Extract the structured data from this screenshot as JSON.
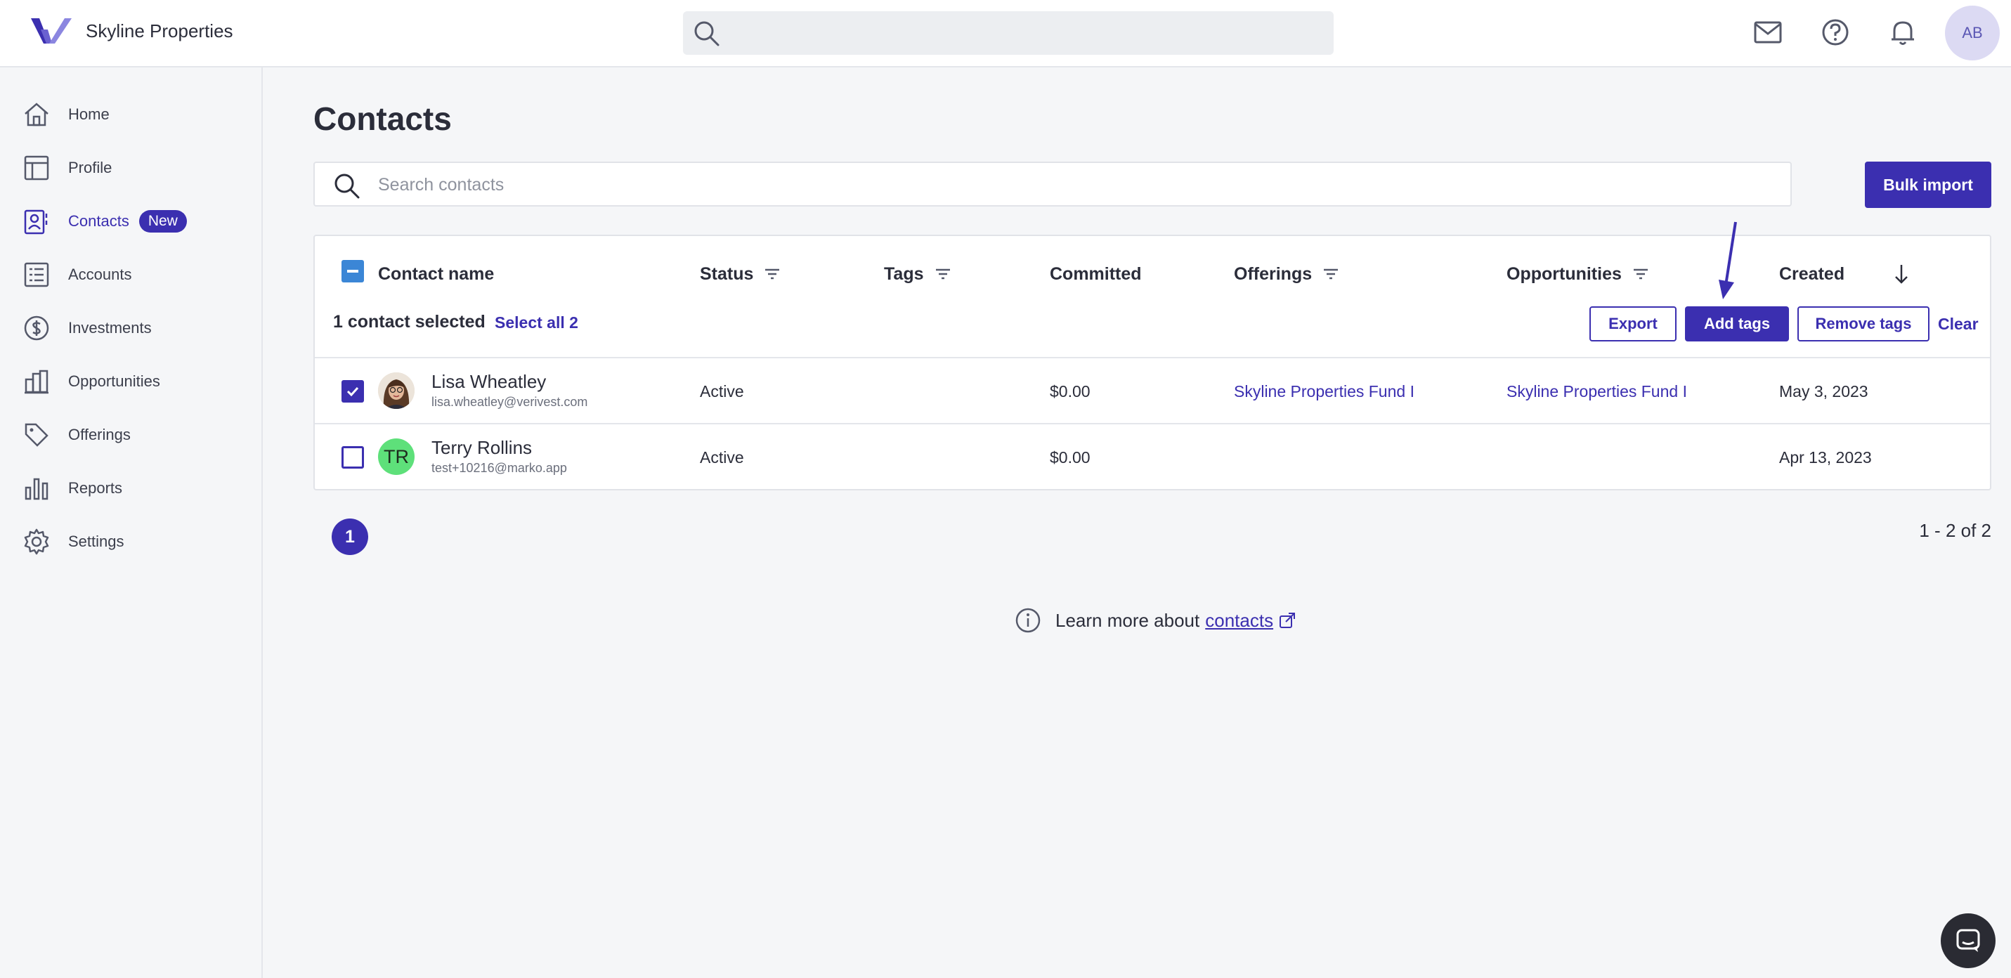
{
  "header": {
    "brand_name": "Skyline Properties",
    "search_placeholder": "",
    "user_initials": "AB",
    "icons": [
      "mail-icon",
      "help-icon",
      "bell-icon"
    ]
  },
  "sidebar": {
    "items": [
      {
        "label": "Home",
        "icon": "home-icon"
      },
      {
        "label": "Profile",
        "icon": "profile-icon"
      },
      {
        "label": "Contacts",
        "icon": "contacts-icon",
        "badge": "New",
        "active": true
      },
      {
        "label": "Accounts",
        "icon": "accounts-icon"
      },
      {
        "label": "Investments",
        "icon": "dollar-icon"
      },
      {
        "label": "Opportunities",
        "icon": "building-icon"
      },
      {
        "label": "Offerings",
        "icon": "tag-icon"
      },
      {
        "label": "Reports",
        "icon": "bar-chart-icon"
      },
      {
        "label": "Settings",
        "icon": "gear-icon"
      }
    ]
  },
  "main": {
    "title": "Contacts",
    "search_placeholder": "Search contacts",
    "bulk_import_label": "Bulk import",
    "table": {
      "columns": [
        "Contact name",
        "Status",
        "Tags",
        "Committed",
        "Offerings",
        "Opportunities",
        "Created"
      ],
      "selection": {
        "count_text": "1 contact selected",
        "select_all_label": "Select all 2",
        "export_label": "Export",
        "add_tags_label": "Add tags",
        "remove_tags_label": "Remove tags",
        "clear_label": "Clear"
      },
      "rows": [
        {
          "name": "Lisa Wheatley",
          "email": "lisa.wheatley@verivest.com",
          "status": "Active",
          "tags": "",
          "committed": "$0.00",
          "offerings": "Skyline Properties Fund I",
          "opportunities": "Skyline Properties Fund I",
          "created": "May 3, 2023",
          "checked": true
        },
        {
          "name": "Terry Rollins",
          "initials": "TR",
          "email": "test+10216@marko.app",
          "status": "Active",
          "tags": "",
          "committed": "$0.00",
          "offerings": "",
          "opportunities": "",
          "created": "Apr 13, 2023",
          "checked": false
        }
      ]
    },
    "pagination": {
      "current_page": "1",
      "range_text": "1 - 2 of 2"
    },
    "learn_more": {
      "text": "Learn more about",
      "link_label": "contacts"
    }
  },
  "colors": {
    "accent": "#3b2fb0",
    "background": "#f5f6f8",
    "avatar_green": "#5ee07a"
  }
}
